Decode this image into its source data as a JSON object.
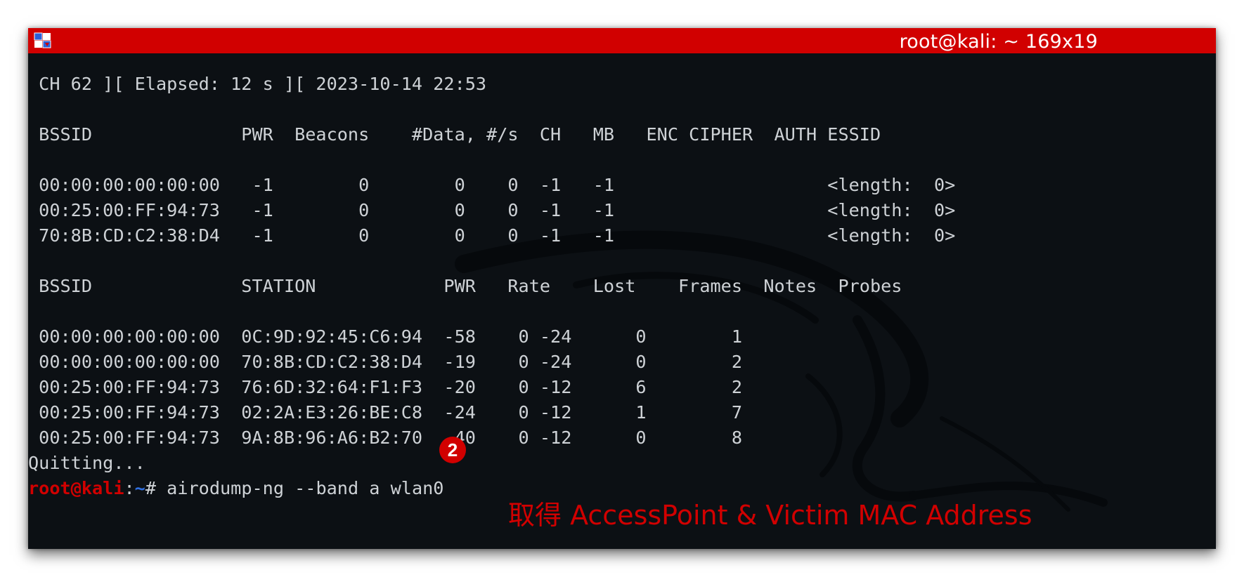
{
  "window": {
    "title": "root@kali: ~ 169x19"
  },
  "terminal": {
    "lines": [
      " CH 62 ][ Elapsed: 12 s ][ 2023-10-14 22:53",
      "",
      " BSSID              PWR  Beacons    #Data, #/s  CH   MB   ENC CIPHER  AUTH ESSID",
      "",
      " 00:00:00:00:00:00   -1        0        0    0  -1   -1                    <length:  0>",
      " 00:25:00:FF:94:73   -1        0        0    0  -1   -1                    <length:  0>",
      " 70:8B:CD:C2:38:D4   -1        0        0    0  -1   -1                    <length:  0>",
      "",
      " BSSID              STATION            PWR   Rate    Lost    Frames  Notes  Probes",
      "",
      " 00:00:00:00:00:00  0C:9D:92:45:C6:94  -58    0 -24      0        1",
      " 00:00:00:00:00:00  70:8B:CD:C2:38:D4  -19    0 -24      0        2",
      " 00:25:00:FF:94:73  76:6D:32:64:F1:F3  -20    0 -12      6        2",
      " 00:25:00:FF:94:73  02:2A:E3:26:BE:C8  -24    0 -12      1        7",
      " 00:25:00:FF:94:73  9A:8B:96:A6:B2:70  -40    0 -12      0        8",
      "Quitting..."
    ],
    "prompt": {
      "user_host": "root@kali",
      "separator": ":",
      "path": "~",
      "symbol": "# ",
      "command": "airodump-ng --band a wlan0"
    }
  },
  "annotation": {
    "badge": "2",
    "caption": "取得 AccessPoint & Victim MAC Address"
  },
  "colors": {
    "titlebar": "#d10000",
    "terminal_bg": "#0c1014",
    "terminal_text": "#ced2d6",
    "prompt_user": "#d10000",
    "prompt_path": "#2f6fe0",
    "annotation": "#d10000"
  }
}
